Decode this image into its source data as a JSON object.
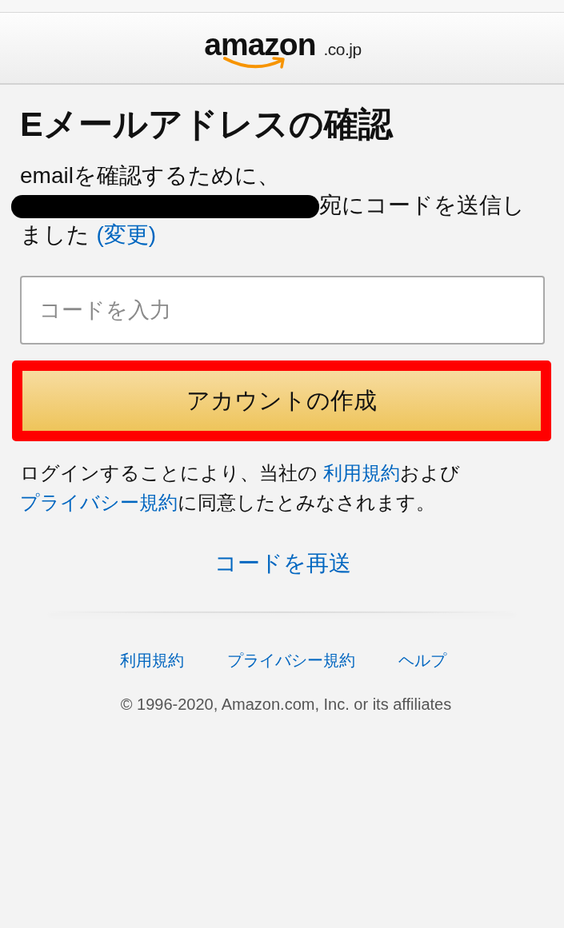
{
  "header": {
    "logo_text": "amazon",
    "logo_suffix": ".co.jp"
  },
  "title": "Eメールアドレスの確認",
  "message": [
    {
      "kind": "text",
      "text": "emailを確認するために、"
    },
    {
      "kind": "redaction"
    },
    {
      "kind": "text",
      "text": "宛にコードを送信しました"
    },
    {
      "kind": "link",
      "text": "(変更)"
    }
  ],
  "code_field": {
    "placeholder": "コードを入力"
  },
  "submit_button": {
    "label": "アカウントの作成",
    "highlighted": true
  },
  "legal_notice": [
    {
      "kind": "text",
      "text": "ログインすることにより、当社の "
    },
    {
      "kind": "link",
      "text": "利用規約"
    },
    {
      "kind": "text",
      "text": "および"
    },
    {
      "kind": "link",
      "text": "プライバシー規約"
    },
    {
      "kind": "text",
      "text": "に同意したとみなされます。"
    }
  ],
  "resend_link": "コードを再送",
  "footer": {
    "links": [
      "利用規約",
      "プライバシー規約",
      "ヘルプ"
    ],
    "copyright": "© 1996-2020, Amazon.com, Inc. or its affiliates"
  }
}
